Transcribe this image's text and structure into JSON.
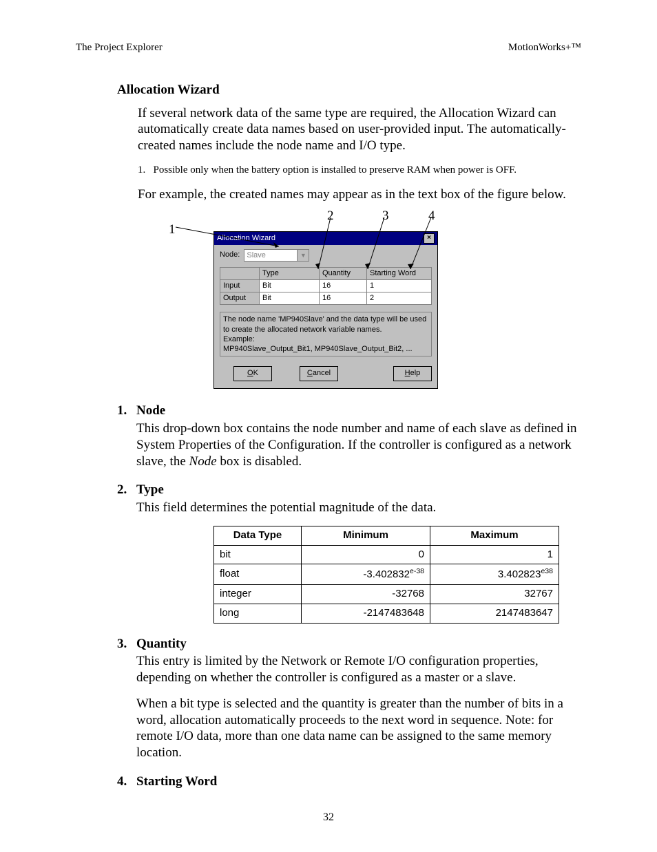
{
  "header": {
    "left": "The Project Explorer",
    "right": "MotionWorks+™"
  },
  "title": "Allocation Wizard",
  "intro": "If several network data of the same type are required, the Allocation Wizard can automatically create data names based on user-provided input.  The automatically-created names include the node name and I/O type.",
  "footnote_num": "1.",
  "footnote": "Possible only when the battery option is installed to preserve RAM when power is OFF.",
  "example_lead": "For example, the created names may appear as in the text box of the figure below.",
  "callouts": {
    "c1": "1",
    "c2": "2",
    "c3": "3",
    "c4": "4"
  },
  "dialog": {
    "title": "Allocation Wizard",
    "node_label": "Node:",
    "node_value": "Slave",
    "grid": {
      "headers": [
        "",
        "Type",
        "Quantity",
        "Starting Word"
      ],
      "rows": [
        {
          "label": "Input",
          "type": "Bit",
          "qty": "16",
          "start": "1"
        },
        {
          "label": "Output",
          "type": "Bit",
          "qty": "16",
          "start": "2"
        }
      ]
    },
    "hint_l1": "The node name 'MP940Slave' and the data type will be used",
    "hint_l2": "to create the allocated network variable names.",
    "hint_l3": "Example:",
    "hint_l4": "MP940Slave_Output_Bit1, MP940Slave_Output_Bit2, ...",
    "ok": "OK",
    "cancel": "Cancel",
    "help": "Help"
  },
  "items": {
    "n1": {
      "num": "1.",
      "title": "Node",
      "text": "This drop-down box contains the node number and name of each slave as defined in System Properties of the Configuration.  If the controller is configured as a network slave, the ",
      "italic": "Node",
      "text2": " box is disabled."
    },
    "n2": {
      "num": "2.",
      "title": "Type",
      "text": "This field determines the potential magnitude of the data."
    },
    "n3": {
      "num": "3.",
      "title": "Quantity",
      "text": "This entry is limited by the Network or Remote I/O configuration properties, depending on whether the controller is configured as a master or a slave.",
      "text2": "When a bit type is selected and the quantity is greater than the number of bits in a word, allocation automatically proceeds to the next word in sequence.  Note:  for remote I/O data, more than one data name can be assigned to the same memory location."
    },
    "n4": {
      "num": "4.",
      "title": "Starting Word"
    }
  },
  "table_headers": {
    "a": "Data Type",
    "b": "Minimum",
    "c": "Maximum"
  },
  "table_rows": [
    {
      "a": "bit",
      "b": "0",
      "c": "1"
    },
    {
      "a": "float",
      "b": "-3.402832",
      "b_sup": "e-38",
      "c": "3.402823",
      "c_sup": "e38"
    },
    {
      "a": "integer",
      "b": "-32768",
      "c": "32767"
    },
    {
      "a": "long",
      "b": "-2147483648",
      "c": "2147483647"
    }
  ],
  "page_num": "32"
}
